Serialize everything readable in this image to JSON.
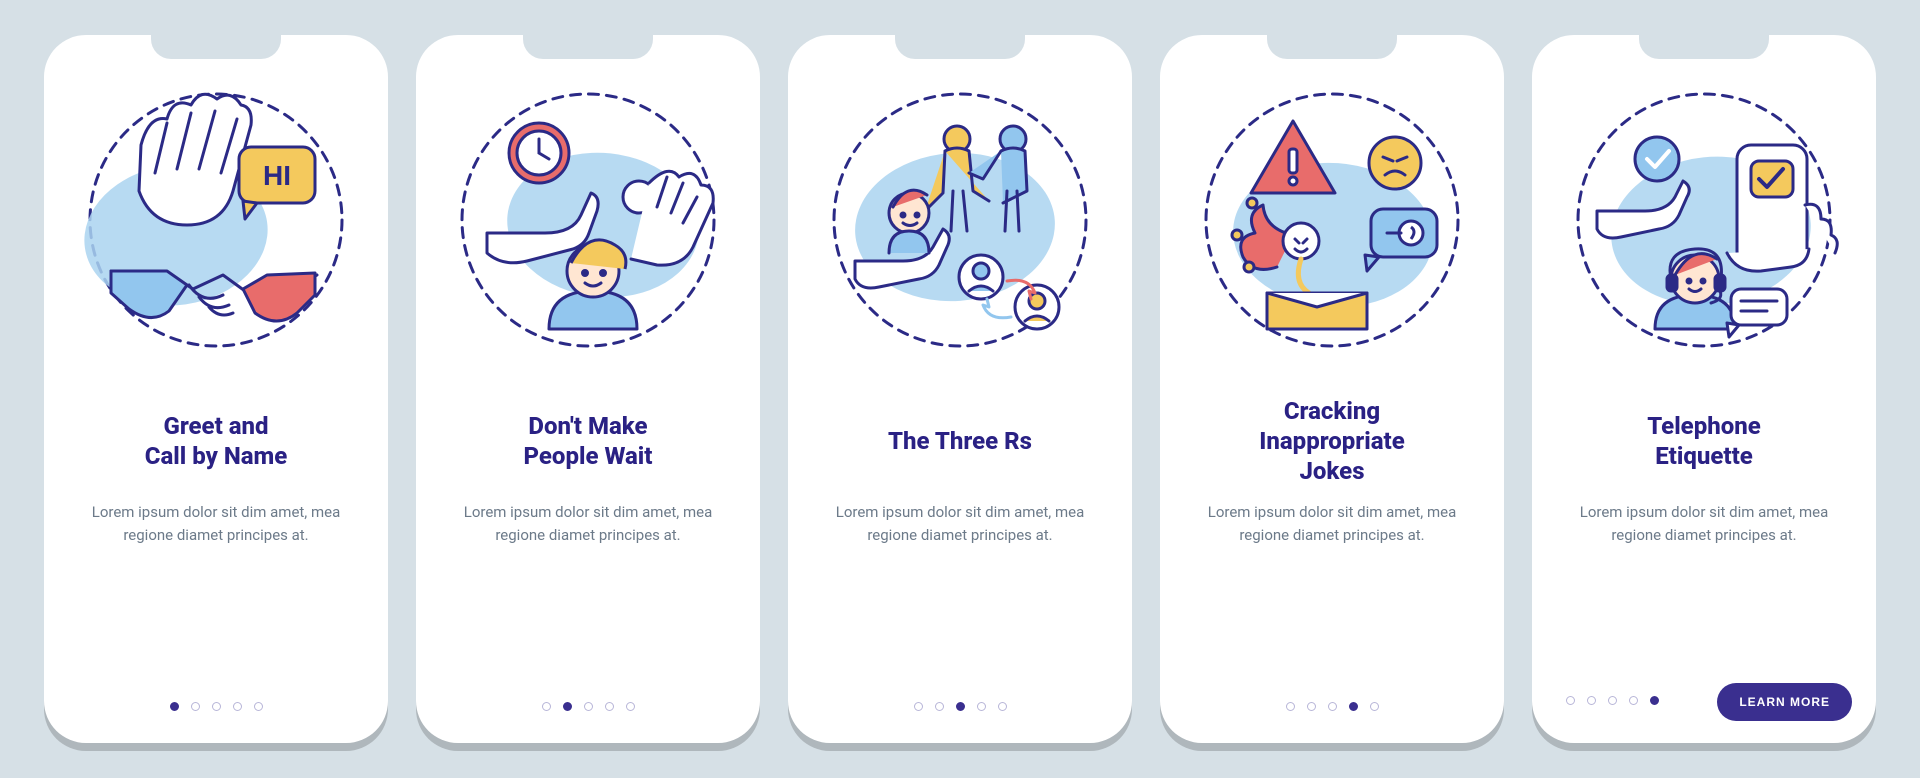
{
  "cards": [
    {
      "title": "Greet and\nCall by Name",
      "desc": "Lorem ipsum dolor sit dim amet, mea regione diamet principes at.",
      "activeDot": 0,
      "illustration": "greet",
      "hiText": "HI"
    },
    {
      "title": "Don't Make\nPeople Wait",
      "desc": "Lorem ipsum dolor sit dim amet, mea regione diamet principes at.",
      "activeDot": 1,
      "illustration": "wait"
    },
    {
      "title": "The Three Rs",
      "desc": "Lorem ipsum dolor sit dim amet, mea regione diamet principes at.",
      "activeDot": 2,
      "illustration": "three-rs"
    },
    {
      "title": "Cracking\nInappropriate\nJokes",
      "desc": "Lorem ipsum dolor sit dim amet, mea regione diamet principes at.",
      "activeDot": 3,
      "illustration": "jokes"
    },
    {
      "title": "Telephone\nEtiquette",
      "desc": "Lorem ipsum dolor sit dim amet, mea regione diamet principes at.",
      "activeDot": 4,
      "illustration": "phone",
      "cta": "LEARN MORE"
    }
  ],
  "dotCount": 5,
  "colors": {
    "ink": "#2b2a86",
    "accentBlue": "#92c6ee",
    "accentRed": "#e86c6b",
    "accentYellow": "#f4c95d"
  }
}
